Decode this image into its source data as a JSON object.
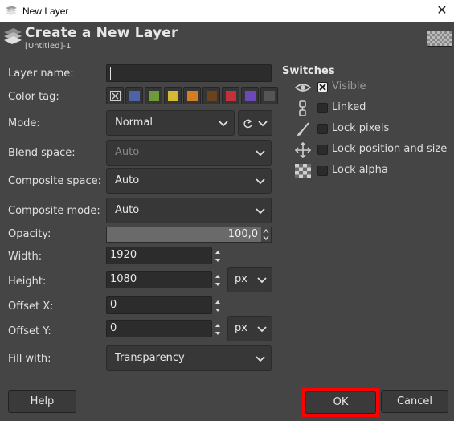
{
  "window": {
    "title": "New Layer"
  },
  "header": {
    "title": "Create a New Layer",
    "subtitle": "[Untitled]-1"
  },
  "form": {
    "layer_name_label": "Layer name:",
    "layer_name_value": "",
    "color_tag_label": "Color tag:",
    "color_tags": [
      {
        "name": "none",
        "color": "none"
      },
      {
        "name": "blue",
        "color": "#4f63a8"
      },
      {
        "name": "green",
        "color": "#6e9a3a"
      },
      {
        "name": "yellow",
        "color": "#d6b932"
      },
      {
        "name": "orange",
        "color": "#d67d24"
      },
      {
        "name": "brown",
        "color": "#6b4220"
      },
      {
        "name": "red",
        "color": "#c2303a"
      },
      {
        "name": "violet",
        "color": "#6d48b8"
      },
      {
        "name": "gray",
        "color": "#555555"
      }
    ],
    "mode_label": "Mode:",
    "mode_value": "Normal",
    "blend_space_label": "Blend space:",
    "blend_space_value": "Auto",
    "composite_space_label": "Composite space:",
    "composite_space_value": "Auto",
    "composite_mode_label": "Composite mode:",
    "composite_mode_value": "Auto",
    "opacity_label": "Opacity:",
    "opacity_value": "100,0",
    "width_label": "Width:",
    "width_value": "1920",
    "height_label": "Height:",
    "height_value": "1080",
    "size_unit": "px",
    "offset_x_label": "Offset X:",
    "offset_x_value": "0",
    "offset_y_label": "Offset Y:",
    "offset_y_value": "0",
    "offset_unit": "px",
    "fill_label": "Fill with:",
    "fill_value": "Transparency"
  },
  "switches": {
    "title": "Switches",
    "items": [
      {
        "label": "Visible",
        "checked": true,
        "icon": "eye-icon"
      },
      {
        "label": "Linked",
        "checked": false,
        "icon": "chain-icon"
      },
      {
        "label": "Lock pixels",
        "checked": false,
        "icon": "brush-icon"
      },
      {
        "label": "Lock position and size",
        "checked": false,
        "icon": "move-icon"
      },
      {
        "label": "Lock alpha",
        "checked": false,
        "icon": "checkerboard-icon"
      }
    ]
  },
  "buttons": {
    "help": "Help",
    "ok": "OK",
    "cancel": "Cancel"
  },
  "colors": {
    "background": "#454545",
    "highlight": "#ff0000"
  }
}
